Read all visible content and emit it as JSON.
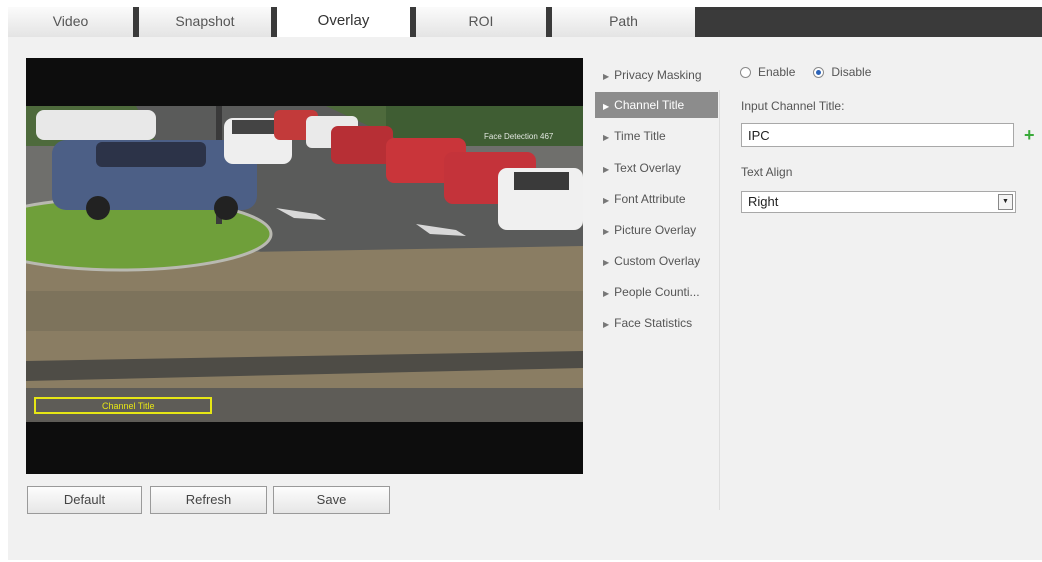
{
  "tabs": [
    {
      "label": "Video",
      "active": false
    },
    {
      "label": "Snapshot",
      "active": false
    },
    {
      "label": "Overlay",
      "active": true
    },
    {
      "label": "ROI",
      "active": false
    },
    {
      "label": "Path",
      "active": false
    }
  ],
  "video": {
    "overlay_label": "Channel Title",
    "corner_text": "Face Detection 467"
  },
  "buttons": {
    "default": "Default",
    "refresh": "Refresh",
    "save": "Save"
  },
  "menu": {
    "items": [
      {
        "label": "Privacy Masking",
        "active": false
      },
      {
        "label": "Channel Title",
        "active": true
      },
      {
        "label": "Time Title",
        "active": false
      },
      {
        "label": "Text Overlay",
        "active": false
      },
      {
        "label": "Font Attribute",
        "active": false
      },
      {
        "label": "Picture Overlay",
        "active": false
      },
      {
        "label": "Custom Overlay",
        "active": false
      },
      {
        "label": "People Counti...",
        "active": false
      },
      {
        "label": "Face Statistics",
        "active": false
      }
    ]
  },
  "form": {
    "enable_label": "Enable",
    "disable_label": "Disable",
    "selected": "Disable",
    "channel_title_label": "Input Channel Title:",
    "channel_title_value": "IPC",
    "text_align_label": "Text Align",
    "text_align_value": "Right"
  },
  "icons": {
    "add": "plus-icon",
    "menu_arrow": "triangle-right-icon",
    "dropdown": "triangle-down-icon"
  },
  "colors": {
    "tab_bar": "#3a3a3a",
    "panel": "#f1f1f1",
    "menu_active": "#8c8c8c",
    "overlay_box": "#e6e615",
    "radio_selected": "#2b63b8",
    "add_icon": "#3aaa3a"
  }
}
